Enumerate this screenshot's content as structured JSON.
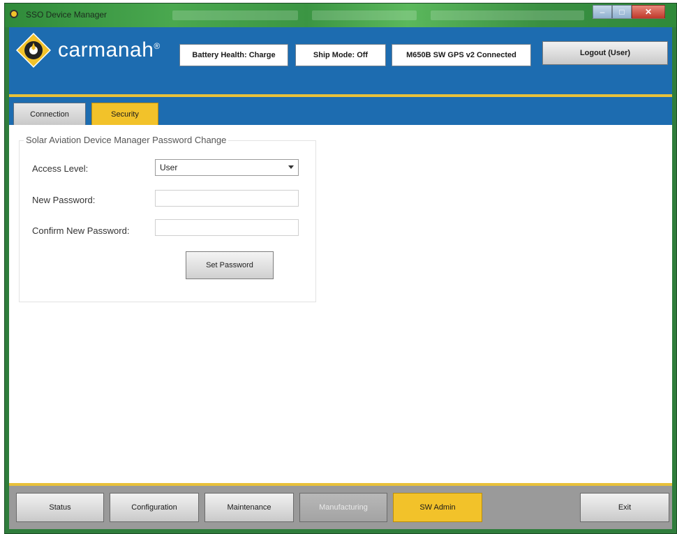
{
  "window": {
    "title": "SSO Device Manager"
  },
  "brand": {
    "logo_text": "carmanah",
    "logo_superscript": "®",
    "colors": {
      "header": "#1d6cb0",
      "accent": "#f2c22a",
      "window_frame": "#2f7d3c"
    }
  },
  "header": {
    "battery_status": "Battery Health: Charge",
    "ship_mode": "Ship Mode: Off",
    "device_status": "M650B SW GPS v2 Connected",
    "logout_label": "Logout (User)"
  },
  "tabs": [
    {
      "label": "Connection"
    },
    {
      "label": "Security"
    }
  ],
  "security": {
    "group_title": "Solar Aviation Device Manager Password Change",
    "access_level_label": "Access Level:",
    "access_level_value": "User",
    "new_password_label": "New Password:",
    "new_password_value": "",
    "confirm_password_label": "Confirm New Password:",
    "confirm_password_value": "",
    "set_password_label": "Set Password"
  },
  "footer": {
    "buttons": [
      {
        "label": "Status"
      },
      {
        "label": "Configuration"
      },
      {
        "label": "Maintenance"
      },
      {
        "label": "Manufacturing"
      },
      {
        "label": "SW Admin"
      },
      {
        "label": "Exit"
      }
    ]
  }
}
